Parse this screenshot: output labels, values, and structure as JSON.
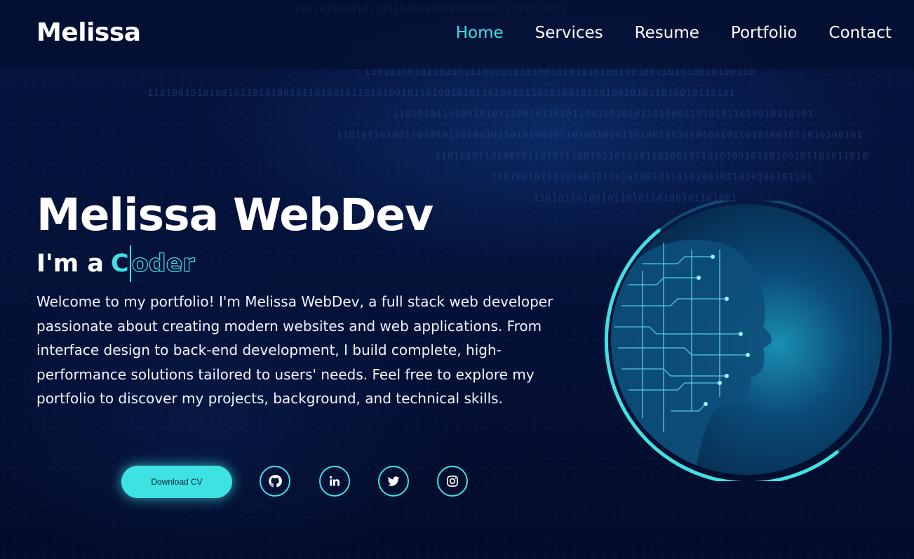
{
  "header": {
    "logo": "Melissa",
    "nav": [
      {
        "label": "Home",
        "active": true
      },
      {
        "label": "Services",
        "active": false
      },
      {
        "label": "Resume",
        "active": false
      },
      {
        "label": "Portfolio",
        "active": false
      },
      {
        "label": "Contact",
        "active": false
      }
    ]
  },
  "hero": {
    "title": "Melissa WebDev",
    "subtitle_prefix": "I'm a",
    "subtitle_typed": "C",
    "subtitle_outline": "oder",
    "intro": "Welcome to my portfolio! I'm Melissa WebDev, a full stack web developer passionate about creating modern websites and web applications. From interface design to back-end development, I build complete, high-performance solutions tailored to users' needs. Feel free to explore my portfolio to discover my projects, background, and technical skills.",
    "download_label": "Download CV"
  },
  "social": [
    {
      "icon": "github-icon"
    },
    {
      "icon": "linkedin-icon"
    },
    {
      "icon": "twitter-icon"
    },
    {
      "icon": "instagram-icon"
    }
  ],
  "colors": {
    "accent": "#3fe2e2",
    "background": "#041136",
    "text": "#ffffff"
  }
}
